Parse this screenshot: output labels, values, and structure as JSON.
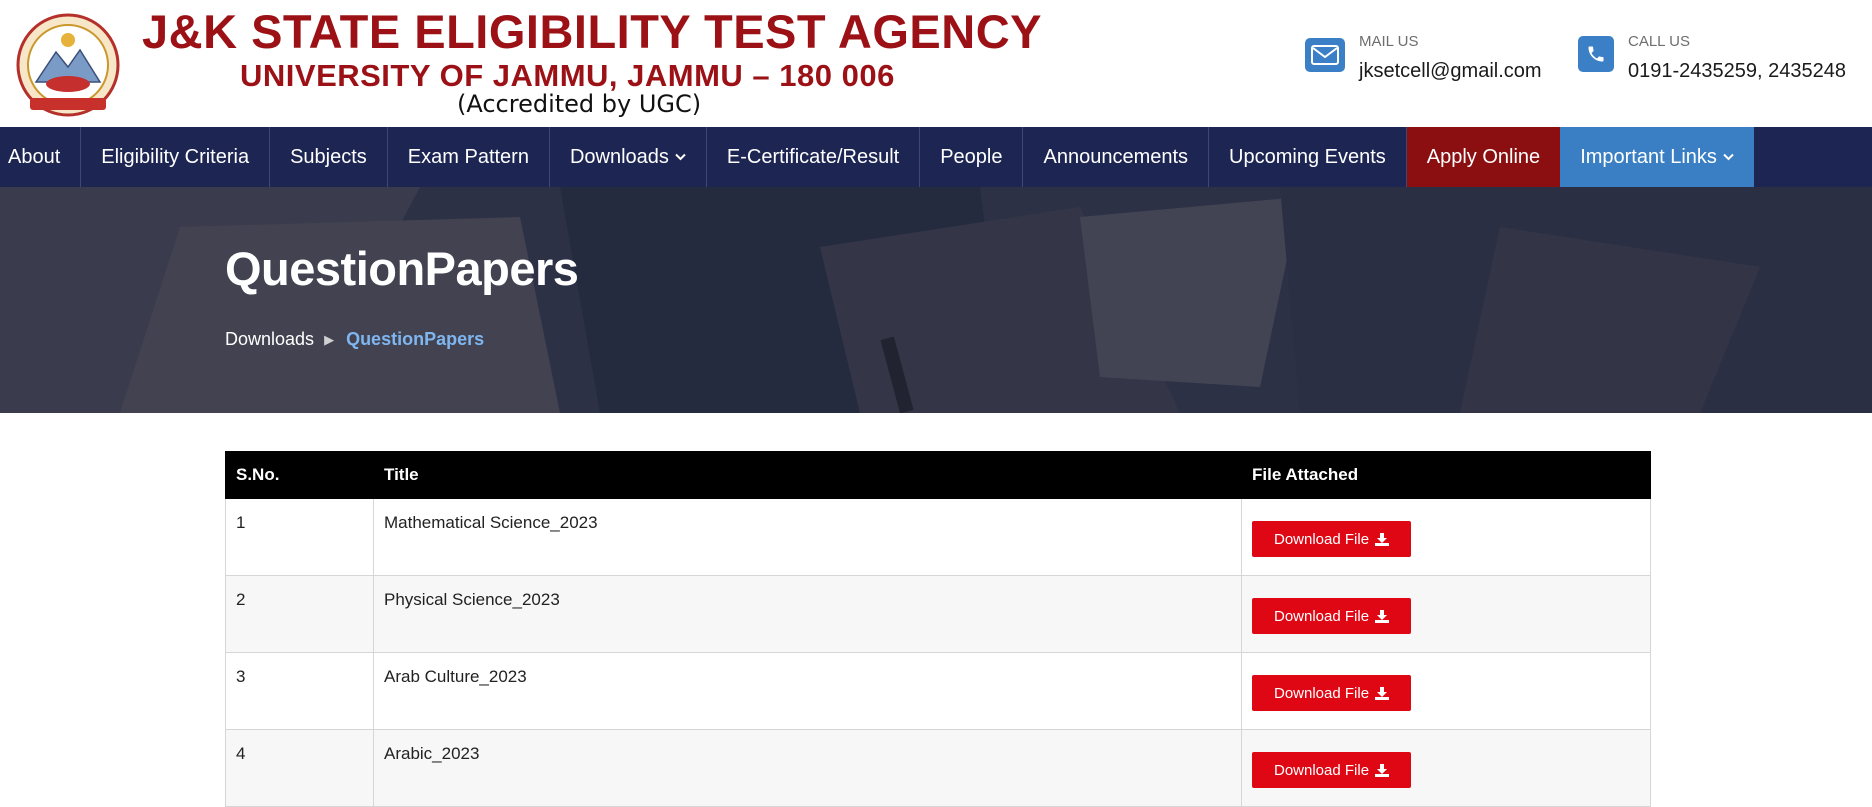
{
  "header": {
    "title": "J&K STATE ELIGIBILITY TEST AGENCY",
    "subtitle": "UNIVERSITY OF JAMMU, JAMMU – 180 006",
    "accreditation": "(Accredited by UGC)",
    "mail": {
      "caption": "MAIL US",
      "value": "jksetcell@gmail.com",
      "icon": "envelope-icon"
    },
    "call": {
      "caption": "CALL US",
      "value": "0191-2435259, 2435248",
      "icon": "phone-icon"
    }
  },
  "nav": {
    "items": [
      {
        "label": "About"
      },
      {
        "label": "Eligibility Criteria"
      },
      {
        "label": "Subjects"
      },
      {
        "label": "Exam Pattern"
      },
      {
        "label": "Downloads"
      },
      {
        "label": "E-Certificate/Result"
      },
      {
        "label": "People"
      },
      {
        "label": "Announcements"
      },
      {
        "label": "Upcoming Events"
      },
      {
        "label": "Apply Online"
      },
      {
        "label": "Important Links"
      }
    ]
  },
  "hero": {
    "title": "QuestionPapers",
    "breadcrumb": {
      "parent": "Downloads",
      "separator": "▶",
      "current": "QuestionPapers"
    }
  },
  "table": {
    "headers": [
      "S.No.",
      "Title",
      "File Attached"
    ],
    "rows": [
      {
        "sno": "1",
        "title": "Mathematical Science_2023",
        "button": "Download File"
      },
      {
        "sno": "2",
        "title": "Physical Science_2023",
        "button": "Download File"
      },
      {
        "sno": "3",
        "title": "Arab Culture_2023",
        "button": "Download File"
      },
      {
        "sno": "4",
        "title": "Arabic_2023",
        "button": "Download File"
      }
    ]
  },
  "colors": {
    "brand_red": "#9b1116",
    "nav_bg": "#1d2653",
    "apply_bg": "#8b0f10",
    "links_bg": "#3a7fc3",
    "download_btn": "#e00714",
    "breadcrumb_current": "#7fb6f0"
  }
}
